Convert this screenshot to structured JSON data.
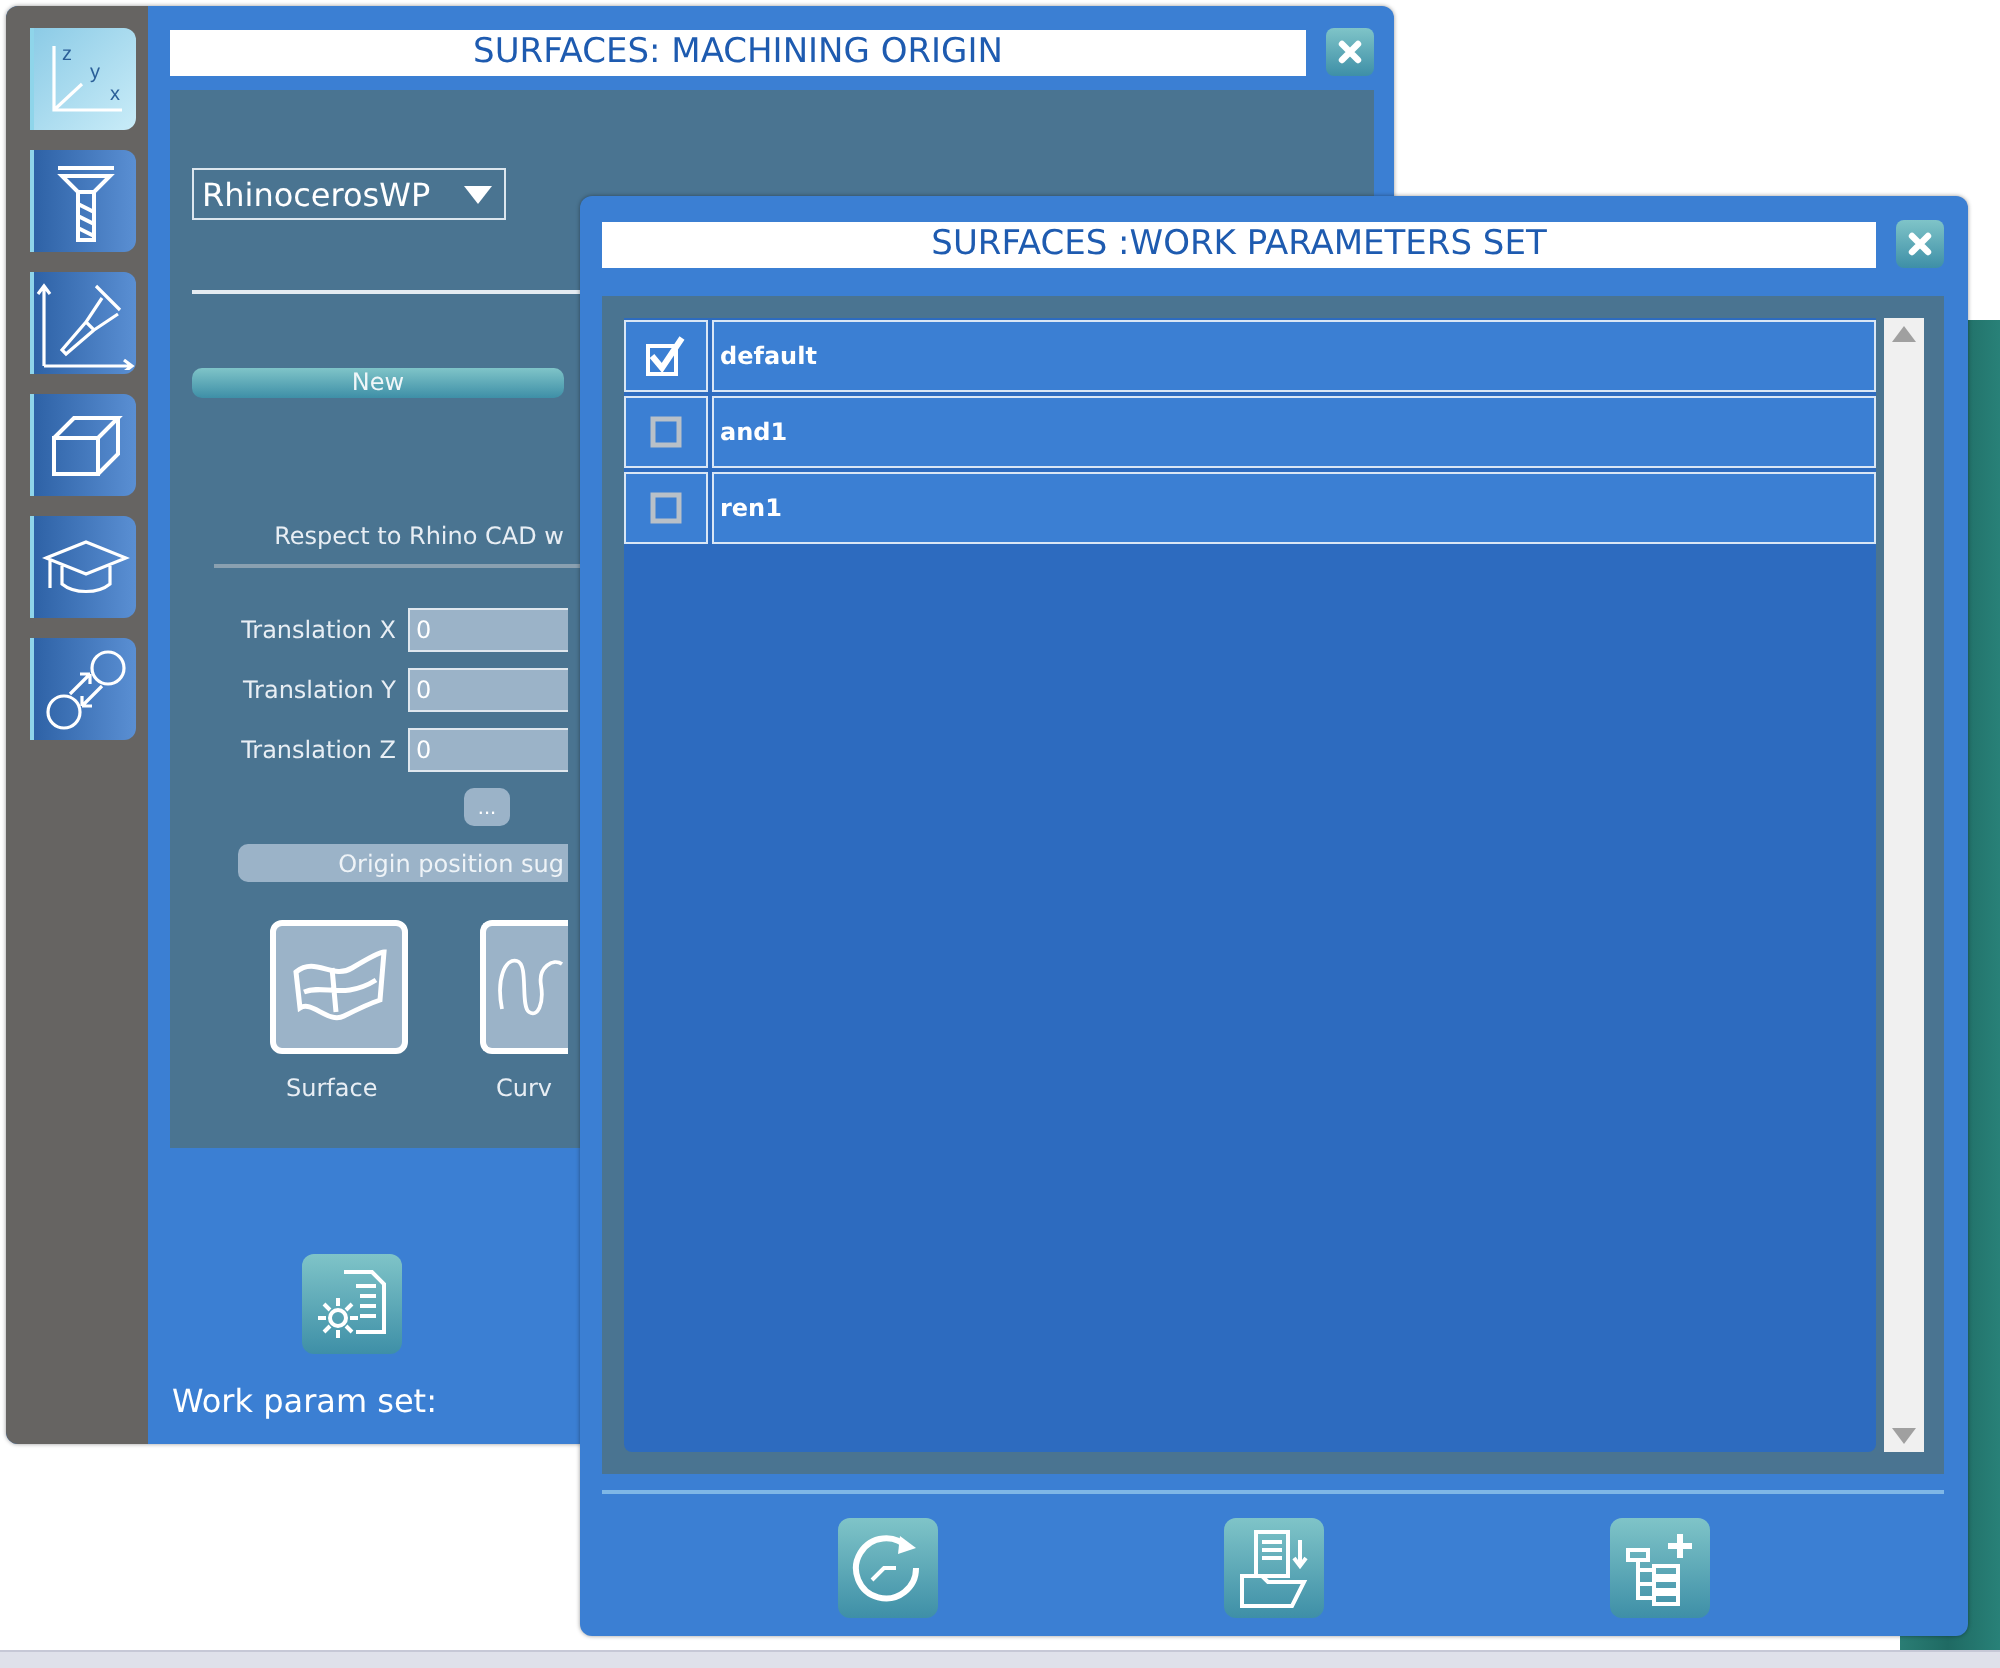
{
  "back_window": {
    "title": "SURFACES: MACHINING ORIGIN",
    "sidebar": [
      {
        "kind": "axes",
        "selected": true,
        "axis_labels": [
          "z",
          "y",
          "x"
        ]
      },
      {
        "kind": "tool",
        "selected": false
      },
      {
        "kind": "tool-path",
        "selected": false
      },
      {
        "kind": "box",
        "selected": false
      },
      {
        "kind": "cap",
        "selected": false
      },
      {
        "kind": "swap",
        "selected": false
      }
    ],
    "origin_dropdown": {
      "value": "RhinocerosWP"
    },
    "new_button": "New",
    "reference_label": "Respect to Rhino CAD w",
    "translations": [
      {
        "label": "Translation X",
        "value": "0"
      },
      {
        "label": "Translation Y",
        "value": "0"
      },
      {
        "label": "Translation Z",
        "value": "0"
      }
    ],
    "more_button": "...",
    "suggest_button": "Origin position sug",
    "geometry_types": [
      {
        "kind": "surface",
        "label": "Surface"
      },
      {
        "kind": "curve",
        "label": "Curv"
      }
    ],
    "work_param_label": "Work param set:"
  },
  "front_window": {
    "title": "SURFACES :WORK PARAMETERS SET",
    "sets": [
      {
        "name": "default",
        "checked": true
      },
      {
        "name": "and1",
        "checked": false
      },
      {
        "name": "ren1",
        "checked": false
      }
    ],
    "actions": [
      {
        "kind": "history"
      },
      {
        "kind": "import"
      },
      {
        "kind": "add-tree"
      }
    ]
  }
}
